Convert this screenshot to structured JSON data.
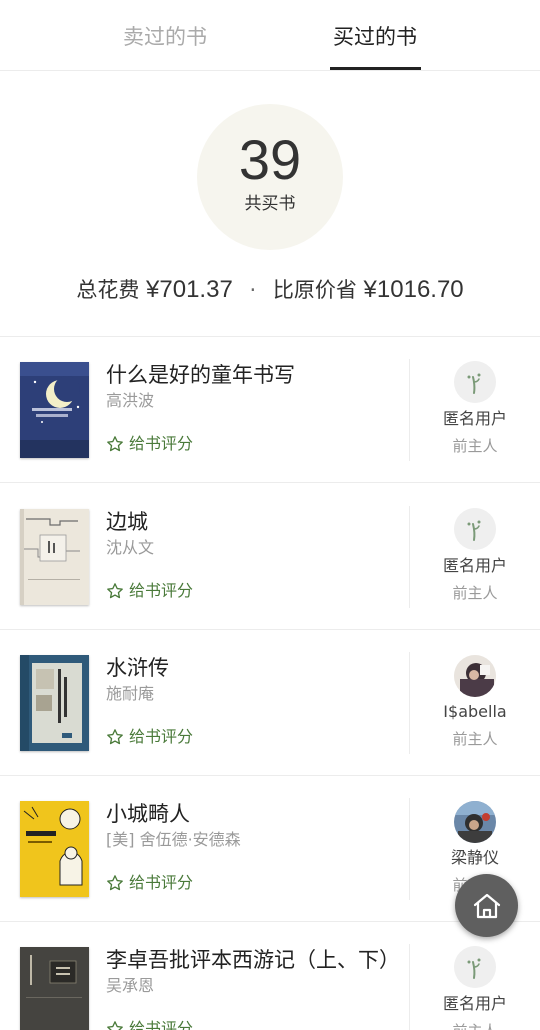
{
  "tabs": {
    "sold": "卖过的书",
    "bought": "买过的书",
    "active": "bought"
  },
  "stats": {
    "count": "39",
    "count_label": "共买书",
    "total_prefix": "总花费",
    "total": "¥701.37",
    "separator": "·",
    "saved_prefix": "比原价省",
    "saved": "¥1016.70"
  },
  "rate_label": "给书评分",
  "books": [
    {
      "title": "什么是好的童年书写",
      "author": "高洪波",
      "owner": "匿名用户",
      "role": "前主人",
      "owner_avatar": "anonymous-avatar-icon"
    },
    {
      "title": "边城",
      "author": "沈从文",
      "owner": "匿名用户",
      "role": "前主人",
      "owner_avatar": "anonymous-avatar-icon"
    },
    {
      "title": "水浒传",
      "author": "施耐庵",
      "owner": "I$abella",
      "role": "前主人",
      "owner_avatar": "photo-avatar"
    },
    {
      "title": "小城畸人",
      "author": "[美] 舍伍德·安德森",
      "owner": "梁静仪",
      "role": "前主人",
      "owner_avatar": "photo-avatar"
    },
    {
      "title": "李卓吾批评本西游记（上、下）",
      "author": "吴承恩",
      "owner": "匿名用户",
      "role": "前主人",
      "owner_avatar": "anonymous-avatar-icon"
    }
  ],
  "colors": {
    "accent_green": "#4a7a3a",
    "circle_bg": "#f6f5ee",
    "fab_bg": "#5f5f5f"
  },
  "fab": {
    "icon": "home-icon"
  }
}
